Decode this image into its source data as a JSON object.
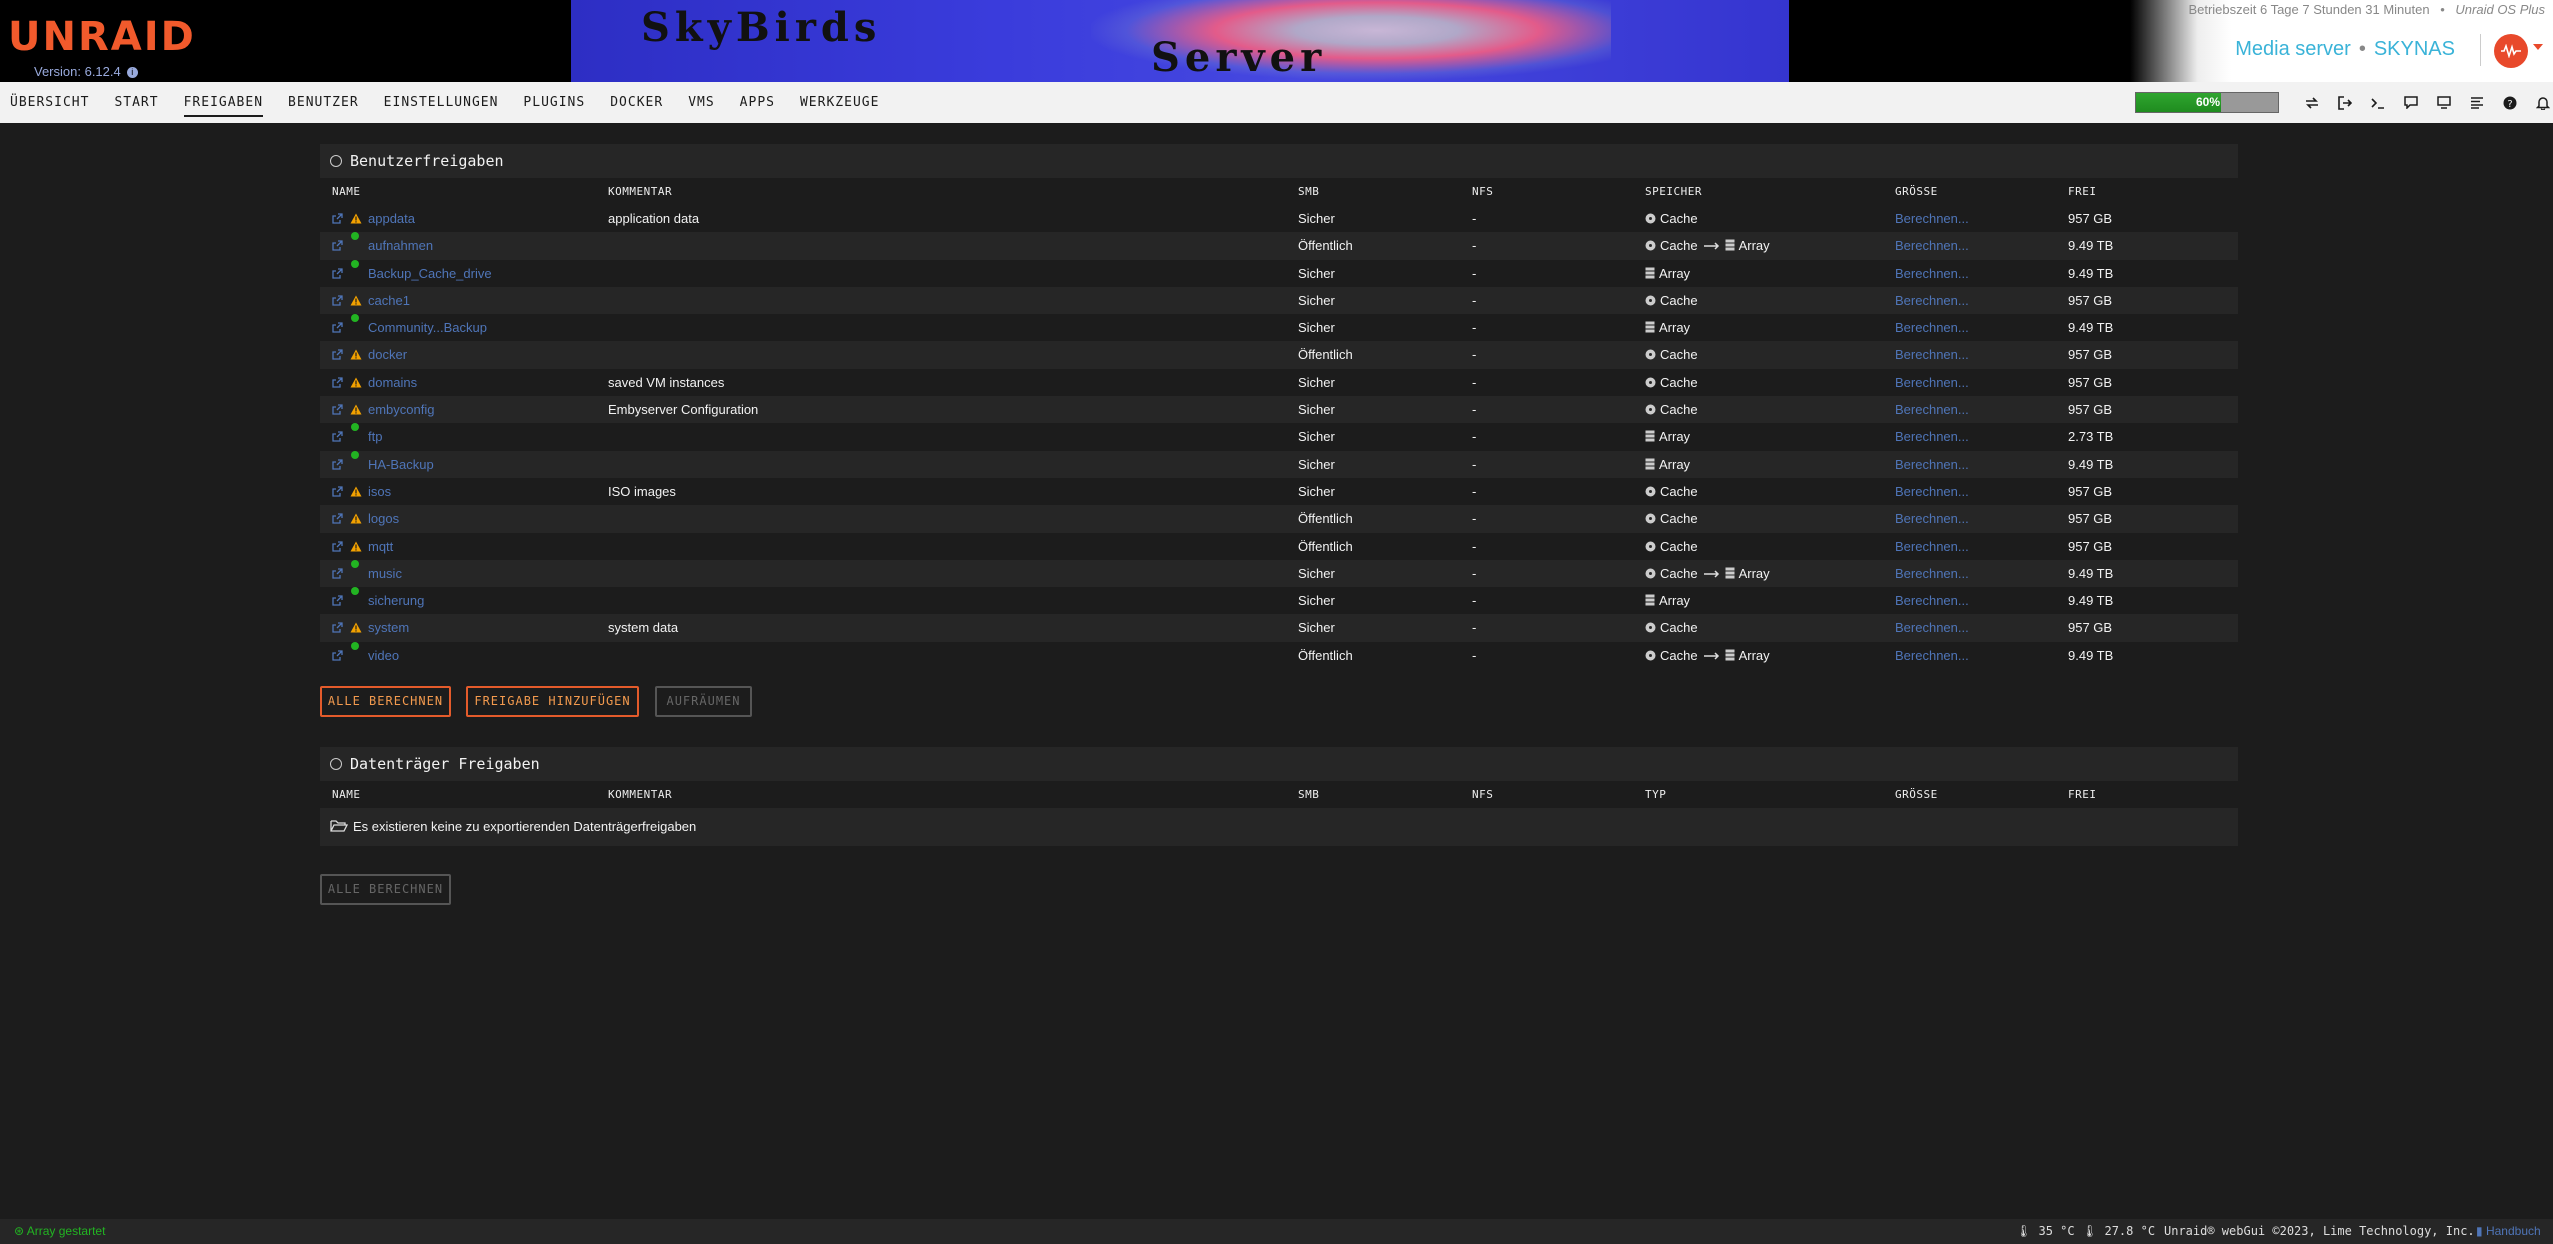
{
  "header": {
    "logo": "UNRAID",
    "version": "Version: 6.12.4",
    "banner_line1": "SkyBirds",
    "banner_line2": "Server",
    "uptime": "Betriebszeit 6 Tage 7 Stunden 31 Minuten",
    "uptime_separator": "•",
    "os_label": "Unraid OS Plus",
    "server_description": "Media server",
    "server_separator": "•",
    "server_name": "SKYNAS"
  },
  "nav": {
    "tabs": [
      "ÜBERSICHT",
      "START",
      "FREIGABEN",
      "BENUTZER",
      "EINSTELLUNGEN",
      "PLUGINS",
      "DOCKER",
      "VMS",
      "APPS",
      "WERKZEUGE"
    ],
    "active_tab": "FREIGABEN",
    "cpu_load_label": "60%",
    "cpu_load_fraction": 0.6,
    "icons": [
      "switch-language-icon",
      "logout-icon",
      "terminal-icon",
      "feedback-icon",
      "info-icon",
      "log-icon",
      "help-icon",
      "notification-bell-icon"
    ]
  },
  "user_shares": {
    "title": "Benutzerfreigaben",
    "columns": {
      "name": "NAME",
      "comment": "KOMMENTAR",
      "smb": "SMB",
      "nfs": "NFS",
      "storage": "SPEICHER",
      "size": "GRÖSSE",
      "free": "FREI"
    },
    "rows": [
      {
        "name": "appdata",
        "status": "warning",
        "comment": "application data",
        "smb": "Sicher",
        "nfs": "-",
        "storage_a": "Cache",
        "storage_b": "",
        "size": "Berechnen...",
        "free": "957 GB"
      },
      {
        "name": "aufnahmen",
        "status": "ok",
        "comment": "",
        "smb": "Öffentlich",
        "nfs": "-",
        "storage_a": "Cache",
        "storage_b": "Array",
        "size": "Berechnen...",
        "free": "9.49 TB"
      },
      {
        "name": "Backup_Cache_drive",
        "status": "ok",
        "comment": "",
        "smb": "Sicher",
        "nfs": "-",
        "storage_a": "Array",
        "storage_b": "",
        "size": "Berechnen...",
        "free": "9.49 TB"
      },
      {
        "name": "cache1",
        "status": "warning",
        "comment": "",
        "smb": "Sicher",
        "nfs": "-",
        "storage_a": "Cache",
        "storage_b": "",
        "size": "Berechnen...",
        "free": "957 GB"
      },
      {
        "name": "Community...Backup",
        "status": "ok",
        "comment": "",
        "smb": "Sicher",
        "nfs": "-",
        "storage_a": "Array",
        "storage_b": "",
        "size": "Berechnen...",
        "free": "9.49 TB"
      },
      {
        "name": "docker",
        "status": "warning",
        "comment": "",
        "smb": "Öffentlich",
        "nfs": "-",
        "storage_a": "Cache",
        "storage_b": "",
        "size": "Berechnen...",
        "free": "957 GB"
      },
      {
        "name": "domains",
        "status": "warning",
        "comment": "saved VM instances",
        "smb": "Sicher",
        "nfs": "-",
        "storage_a": "Cache",
        "storage_b": "",
        "size": "Berechnen...",
        "free": "957 GB"
      },
      {
        "name": "embyconfig",
        "status": "warning",
        "comment": "Embyserver Configuration",
        "smb": "Sicher",
        "nfs": "-",
        "storage_a": "Cache",
        "storage_b": "",
        "size": "Berechnen...",
        "free": "957 GB"
      },
      {
        "name": "ftp",
        "status": "ok",
        "comment": "",
        "smb": "Sicher",
        "nfs": "-",
        "storage_a": "Array",
        "storage_b": "",
        "size": "Berechnen...",
        "free": "2.73 TB"
      },
      {
        "name": "HA-Backup",
        "status": "ok",
        "comment": "",
        "smb": "Sicher",
        "nfs": "-",
        "storage_a": "Array",
        "storage_b": "",
        "size": "Berechnen...",
        "free": "9.49 TB"
      },
      {
        "name": "isos",
        "status": "warning",
        "comment": "ISO images",
        "smb": "Sicher",
        "nfs": "-",
        "storage_a": "Cache",
        "storage_b": "",
        "size": "Berechnen...",
        "free": "957 GB"
      },
      {
        "name": "logos",
        "status": "warning",
        "comment": "",
        "smb": "Öffentlich",
        "nfs": "-",
        "storage_a": "Cache",
        "storage_b": "",
        "size": "Berechnen...",
        "free": "957 GB"
      },
      {
        "name": "mqtt",
        "status": "warning",
        "comment": "",
        "smb": "Öffentlich",
        "nfs": "-",
        "storage_a": "Cache",
        "storage_b": "",
        "size": "Berechnen...",
        "free": "957 GB"
      },
      {
        "name": "music",
        "status": "ok",
        "comment": "",
        "smb": "Sicher",
        "nfs": "-",
        "storage_a": "Cache",
        "storage_b": "Array",
        "size": "Berechnen...",
        "free": "9.49 TB"
      },
      {
        "name": "sicherung",
        "status": "ok",
        "comment": "",
        "smb": "Sicher",
        "nfs": "-",
        "storage_a": "Array",
        "storage_b": "",
        "size": "Berechnen...",
        "free": "9.49 TB"
      },
      {
        "name": "system",
        "status": "warning",
        "comment": "system data",
        "smb": "Sicher",
        "nfs": "-",
        "storage_a": "Cache",
        "storage_b": "",
        "size": "Berechnen...",
        "free": "957 GB"
      },
      {
        "name": "video",
        "status": "ok",
        "comment": "",
        "smb": "Öffentlich",
        "nfs": "-",
        "storage_a": "Cache",
        "storage_b": "Array",
        "size": "Berechnen...",
        "free": "9.49 TB"
      }
    ],
    "buttons": {
      "compute_all": "ALLE BERECHNEN",
      "add_share": "FREIGABE HINZUFÜGEN",
      "clean_up": "AUFRÄUMEN"
    }
  },
  "disk_shares": {
    "title": "Datenträger Freigaben",
    "columns": {
      "name": "NAME",
      "comment": "KOMMENTAR",
      "smb": "SMB",
      "nfs": "NFS",
      "type": "TYP",
      "size": "GRÖSSE",
      "free": "FREI"
    },
    "empty_message": "Es existieren keine zu exportierenden Datenträgerfreigaben",
    "buttons": {
      "compute_all": "ALLE BERECHNEN"
    }
  },
  "footer": {
    "array_status": "Array gestartet",
    "temp1": "35 °C",
    "temp2": "27.8 °C",
    "copyright": "Unraid® webGui ©2023, Lime Technology, Inc.",
    "manual": "Handbuch"
  },
  "colors": {
    "accent_orange": "#e45b2b",
    "link_blue": "#4f75b8",
    "status_green": "#22b422",
    "warning_orange": "#f2a100",
    "server_name_cyan": "#3ab3d8"
  }
}
